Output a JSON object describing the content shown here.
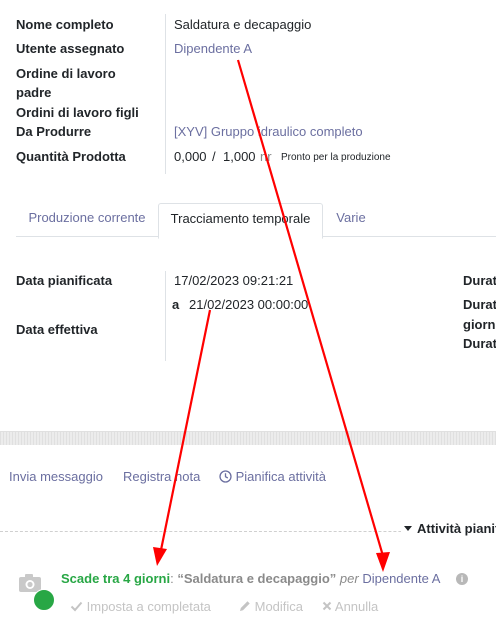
{
  "fields": {
    "nome_completo_label": "Nome completo",
    "nome_completo_value": "Saldatura e decapaggio",
    "utente_label": "Utente assegnato",
    "utente_value": "Dipendente A",
    "ordine_padre_label_1": "Ordine di lavoro",
    "ordine_padre_label_2": "padre",
    "ordini_figli_label": "Ordini di lavoro figli",
    "da_produrre_label": "Da Produrre",
    "da_produrre_value": "[XYV] Gruppo idraulico completo",
    "quantita_label": "Quantità Prodotta",
    "quantita_done": "0,000",
    "quantita_slash": "/",
    "quantita_total": "1,000",
    "quantita_uom": "nr",
    "quantita_status": "Pronto per la produzione"
  },
  "tabs": [
    {
      "label": "Produzione corrente"
    },
    {
      "label": "Tracciamento temporale"
    },
    {
      "label": "Varie"
    }
  ],
  "tracking": {
    "data_pianificata_label": "Data pianificata",
    "data_pianificata_start": "17/02/2023 09:21:21",
    "date_to_prefix": "a",
    "data_pianificata_end": "21/02/2023 00:00:00",
    "data_effettiva_label": "Data effettiva",
    "durata_label_1": "Durat",
    "durata_label_2": "Durat",
    "durata_label_3": "giorn",
    "durata_label_4": "Durat"
  },
  "chatter": {
    "send_message": "Invia messaggio",
    "log_note": "Registra nota",
    "schedule_activity": "Pianifica attività",
    "activities_header": "Attività pianif"
  },
  "activity": {
    "due_text": "Scade tra 4 giorni",
    "colon": ":",
    "summary": "“Saldatura e decapaggio”",
    "per": "per",
    "assignee": "Dipendente A",
    "mark_done": "Imposta a completata",
    "edit": "Modifica",
    "cancel": "Annulla"
  },
  "colors": {
    "link": "#6b6fa0",
    "due_green": "#28a745",
    "annotation_red": "#ff0000"
  },
  "icons": [
    "clock-icon",
    "caret-down-icon",
    "info-icon",
    "camera-icon",
    "check-icon",
    "pencil-icon",
    "times-icon"
  ]
}
